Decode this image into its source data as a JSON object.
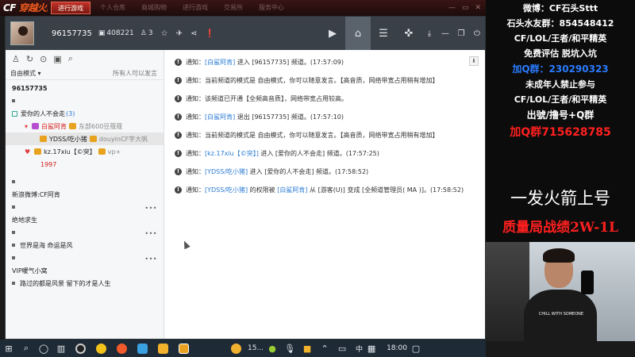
{
  "game_bar": {
    "logo_main": "CF",
    "logo_sub": "穿越火线",
    "tabs": [
      {
        "label": "进行游戏",
        "active": true
      },
      {
        "label": "个人仓库",
        "active": false
      },
      {
        "label": "商城购物",
        "active": false
      },
      {
        "label": "进行游戏",
        "active": false
      },
      {
        "label": "交易所",
        "active": false
      },
      {
        "label": "服务中心",
        "active": false
      }
    ]
  },
  "header": {
    "user_id": "96157735",
    "fans": "408221",
    "members": "3",
    "nav_icons": [
      "video-icon",
      "home-icon",
      "list-icon",
      "gamepad-icon",
      "download-icon",
      "minimize-icon",
      "restore-icon",
      "power-icon"
    ]
  },
  "sidebar": {
    "mode": "自由模式",
    "permission": "所有人可以发言",
    "items": [
      {
        "text": "96157735",
        "bold": true
      },
      {
        "text": "爱你的人不会走",
        "count": "(3)"
      },
      {
        "name": "白鲨阿肯",
        "extra": "东部600豆蔻蔻"
      },
      {
        "name": "YDSS/吃小猪",
        "extra": "douyinCF字大帆"
      },
      {
        "name": "kz.17xiu【©突】",
        "extra": "vp+"
      },
      {
        "text": "1997"
      },
      {
        "text": "新浪微博:CF阿肯"
      },
      {
        "text": "绝地求生"
      },
      {
        "text": "世界是海   命运是风"
      },
      {
        "text": "VIP暖气小窝"
      },
      {
        "text": "路过的都是风景  留下的才是人生"
      }
    ]
  },
  "chat": {
    "messages": [
      {
        "prefix": "通知：",
        "parts": [
          {
            "t": "[白鲨阿肯]",
            "link": true
          },
          {
            "t": " 进入 [96157735] 频道。(17:57:09)",
            "link": false
          }
        ]
      },
      {
        "prefix": "通知：",
        "parts": [
          {
            "t": "当前频道的模式是 自由模式，你可以随意发言。【高音质，网络带宽占用稍有增加】",
            "link": false
          }
        ]
      },
      {
        "prefix": "通知：",
        "parts": [
          {
            "t": "该频道已开通【全频高音质】，网络带宽占用较高。",
            "link": false
          }
        ]
      },
      {
        "prefix": "通知：",
        "parts": [
          {
            "t": "[白鲨阿肯]",
            "link": true
          },
          {
            "t": " 退出 [96157735] 频道。(17:57:10)",
            "link": false
          }
        ]
      },
      {
        "prefix": "通知：",
        "parts": [
          {
            "t": "当前频道的模式是 自由模式，你可以随意发言。【高音质，网络带宽占用稍有增加】",
            "link": false
          }
        ]
      },
      {
        "prefix": "通知：",
        "parts": [
          {
            "t": "[kz.17xiu【©突】]",
            "link": true
          },
          {
            "t": " 进入 [爱你的人不会走] 频道。(17:57:25)",
            "link": false
          }
        ]
      },
      {
        "prefix": "通知：",
        "parts": [
          {
            "t": "[YDSS/吃小猪]",
            "link": true
          },
          {
            "t": " 进入 [爱你的人不会走] 频道。(17:58:52)",
            "link": false
          }
        ]
      },
      {
        "prefix": "通知：",
        "parts": [
          {
            "t": "[YDSS/吃小猪]",
            "link": true
          },
          {
            "t": " 的权限被 ",
            "link": false
          },
          {
            "t": "[白鲨阿肯]",
            "link": true
          },
          {
            "t": " 从 [游客(U)] 变成 [全频道管理员( MA )]。(17:58:52)",
            "link": false
          }
        ]
      }
    ]
  },
  "overlay": {
    "lines": [
      {
        "text": "微博：CF石头Sttt",
        "color": "#ffffff",
        "size": 11
      },
      {
        "text": "石头水友群：854548412",
        "color": "#ffffff",
        "size": 11
      },
      {
        "text": "CF/LOL/王者/和平精英",
        "color": "#ffffff",
        "size": 11
      },
      {
        "text": "免费评估 脱坑入坑",
        "color": "#ffffff",
        "size": 11
      },
      {
        "text": "加Q群：230290323",
        "color": "#2a7bff",
        "size": 12
      },
      {
        "text": "未成年人禁止参与",
        "color": "#ffffff",
        "size": 11
      },
      {
        "text": "CF/LOL/王者/和平精英",
        "color": "#ffffff",
        "size": 11
      },
      {
        "text": "出號/撸号+Q群",
        "color": "#ffffff",
        "size": 12
      },
      {
        "text": "加Q群715628785",
        "color": "#ff2020",
        "size": 14
      }
    ],
    "big1": "一发火箭上号",
    "big2": "质量局战绩2W-1L"
  },
  "cam": {
    "shirt_text": "CHILL WITH SOMEONE"
  },
  "taskbar": {
    "temp": "15...",
    "lang": "中",
    "time": "18:00"
  }
}
